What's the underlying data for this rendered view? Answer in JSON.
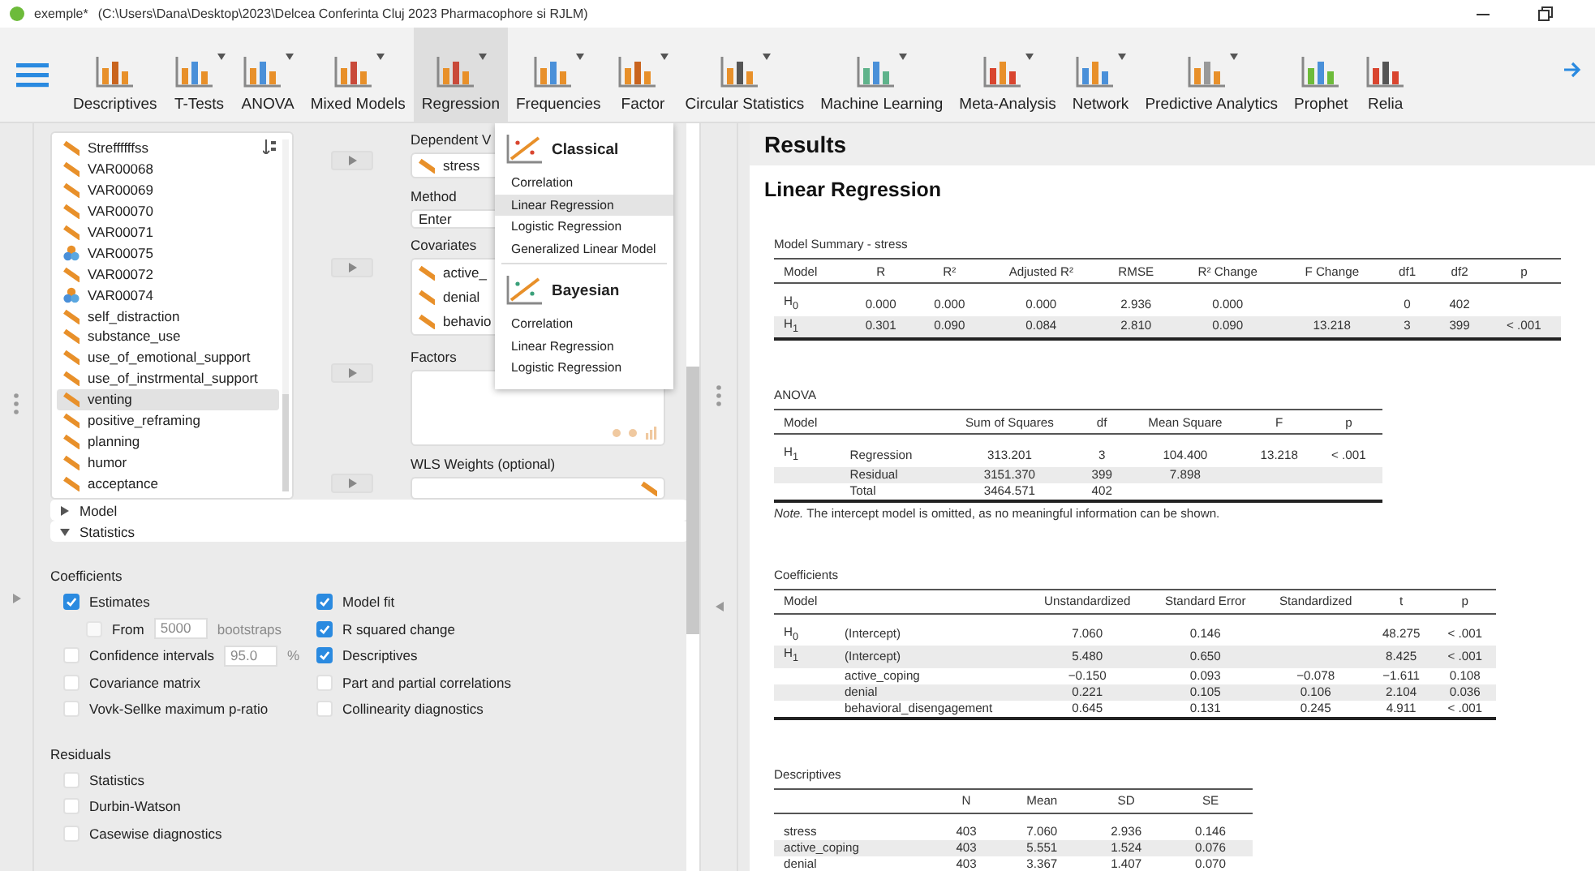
{
  "title_bar": {
    "app": "exemple*",
    "path": "(C:\\Users\\Dana\\Desktop\\2023\\Delcea Conferinta Cluj 2023 Pharmacophore si RJLM)"
  },
  "toolbar": {
    "items": [
      {
        "label": "Descriptives",
        "menu": false,
        "selected": false
      },
      {
        "label": "T-Tests",
        "menu": true,
        "selected": false
      },
      {
        "label": "ANOVA",
        "menu": true,
        "selected": false
      },
      {
        "label": "Mixed Models",
        "menu": true,
        "selected": false
      },
      {
        "label": "Regression",
        "menu": true,
        "selected": true
      },
      {
        "label": "Frequencies",
        "menu": true,
        "selected": false
      },
      {
        "label": "Factor",
        "menu": true,
        "selected": false
      },
      {
        "label": "Circular Statistics",
        "menu": true,
        "selected": false
      },
      {
        "label": "Machine Learning",
        "menu": true,
        "selected": false
      },
      {
        "label": "Meta-Analysis",
        "menu": true,
        "selected": false
      },
      {
        "label": "Network",
        "menu": true,
        "selected": false
      },
      {
        "label": "Predictive Analytics",
        "menu": true,
        "selected": false
      },
      {
        "label": "Prophet",
        "menu": false,
        "selected": false
      },
      {
        "label": "Relia",
        "menu": false,
        "selected": false
      }
    ]
  },
  "variables": [
    {
      "name": "Streffffffss",
      "kind": "scale",
      "selected": false
    },
    {
      "name": "VAR00068",
      "kind": "scale",
      "selected": false
    },
    {
      "name": "VAR00069",
      "kind": "scale",
      "selected": false
    },
    {
      "name": "VAR00070",
      "kind": "scale",
      "selected": false
    },
    {
      "name": "VAR00071",
      "kind": "scale",
      "selected": false
    },
    {
      "name": "VAR00075",
      "kind": "nominal",
      "selected": false
    },
    {
      "name": "VAR00072",
      "kind": "scale",
      "selected": false
    },
    {
      "name": "VAR00074",
      "kind": "nominal",
      "selected": false
    },
    {
      "name": "self_distraction",
      "kind": "scale",
      "selected": false
    },
    {
      "name": "substance_use",
      "kind": "scale",
      "selected": false
    },
    {
      "name": "use_of_emotional_support",
      "kind": "scale",
      "selected": false
    },
    {
      "name": "use_of_instrmental_support",
      "kind": "scale",
      "selected": false
    },
    {
      "name": "venting",
      "kind": "scale",
      "selected": true
    },
    {
      "name": "positive_reframing",
      "kind": "scale",
      "selected": false
    },
    {
      "name": "planning",
      "kind": "scale",
      "selected": false
    },
    {
      "name": "humor",
      "kind": "scale",
      "selected": false
    },
    {
      "name": "acceptance",
      "kind": "scale",
      "selected": false
    }
  ],
  "assign": {
    "dependent_label": "Dependent V",
    "dependent": "stress",
    "method_label": "Method",
    "method": "Enter",
    "covariates_label": "Covariates",
    "covariates": [
      "active_",
      "denial",
      "behavio"
    ],
    "factors_label": "Factors",
    "wls_label": "WLS Weights (optional)"
  },
  "menu": {
    "groups": [
      {
        "title": "Classical",
        "items": [
          {
            "label": "Correlation",
            "selected": false
          },
          {
            "label": "Linear Regression",
            "selected": true
          },
          {
            "label": "Logistic Regression",
            "selected": false
          },
          {
            "label": "Generalized Linear Model",
            "selected": false
          }
        ]
      },
      {
        "title": "Bayesian",
        "items": [
          {
            "label": "Correlation",
            "selected": false
          },
          {
            "label": "Linear Regression",
            "selected": false
          },
          {
            "label": "Logistic Regression",
            "selected": false
          }
        ]
      }
    ]
  },
  "sections": [
    {
      "label": "Model",
      "expanded": false
    },
    {
      "label": "Statistics",
      "expanded": true
    }
  ],
  "coefficients_label": "Coefficients",
  "options_left": [
    {
      "kind": "check",
      "label": "Estimates",
      "checked": true
    },
    {
      "kind": "bootstrap",
      "label": "From",
      "value": "5000",
      "unit": "bootstraps",
      "checked": false
    },
    {
      "kind": "interval",
      "label": "Confidence intervals",
      "value": "95.0",
      "unit": "%",
      "checked": false
    },
    {
      "kind": "check",
      "label": "Covariance matrix",
      "checked": false
    },
    {
      "kind": "check",
      "label": "Vovk-Sellke maximum p-ratio",
      "checked": false
    }
  ],
  "options_right": [
    {
      "kind": "check",
      "label": "Model fit",
      "checked": true
    },
    {
      "kind": "check",
      "label": "R squared change",
      "checked": true
    },
    {
      "kind": "check",
      "label": "Descriptives",
      "checked": true
    },
    {
      "kind": "check",
      "label": "Part and partial correlations",
      "checked": false
    },
    {
      "kind": "check",
      "label": "Collinearity diagnostics",
      "checked": false
    }
  ],
  "residuals": {
    "label": "Residuals",
    "options": [
      {
        "label": "Statistics",
        "checked": false
      },
      {
        "label": "Durbin-Watson",
        "checked": false
      },
      {
        "label": "Casewise diagnostics",
        "checked": false
      }
    ]
  },
  "results": {
    "title": "Results",
    "analysis": "Linear Regression",
    "tables": [
      {
        "title": "Model Summary - stress",
        "columns": [
          {
            "kind": "label",
            "label": "Model"
          },
          {
            "kind": "number",
            "label": "R"
          },
          {
            "kind": "number",
            "label": "R²"
          },
          {
            "kind": "number",
            "label": "Adjusted R²"
          },
          {
            "kind": "number",
            "label": "RMSE"
          },
          {
            "kind": "number",
            "label": "R² Change"
          },
          {
            "kind": "number",
            "label": "F Change"
          },
          {
            "kind": "number",
            "label": "df1"
          },
          {
            "kind": "number",
            "label": "df2"
          },
          {
            "kind": "number",
            "label": "p"
          }
        ],
        "rows": [
          [
            "H$_{0}$",
            "0.000",
            "0.000",
            "0.000",
            "2.936",
            "0.000",
            null,
            "0",
            "402",
            null
          ],
          [
            "H$_{1}$",
            "0.301",
            "0.090",
            "0.084",
            "2.810",
            "0.090",
            "13.218",
            "3",
            "399",
            "< .001"
          ]
        ]
      },
      {
        "title": "ANOVA",
        "columns": [
          {
            "kind": "label",
            "label": "Model"
          },
          {
            "kind": "label"
          },
          {
            "kind": "number",
            "label": "Sum of Squares"
          },
          {
            "kind": "number",
            "label": "df"
          },
          {
            "kind": "number",
            "label": "Mean Square"
          },
          {
            "kind": "number",
            "label": "F"
          },
          {
            "kind": "number",
            "label": "p"
          }
        ],
        "rows": [
          [
            "H$_{1}$",
            "Regression",
            "313.201",
            "3",
            "104.400",
            "13.218",
            "< .001"
          ],
          [
            null,
            "Residual",
            "3151.370",
            "399",
            "7.898",
            null,
            null
          ],
          [
            null,
            "Total",
            "3464.571",
            "402",
            null,
            null,
            null
          ]
        ],
        "note": "*Note.* The intercept model is omitted, as no meaningful information can be shown."
      },
      {
        "title": "Coefficients",
        "columns": [
          {
            "kind": "label",
            "label": "Model"
          },
          {
            "kind": "label"
          },
          {
            "kind": "number",
            "label": "Unstandardized"
          },
          {
            "kind": "number",
            "label": "Standard Error"
          },
          {
            "kind": "number",
            "label": "Standardized"
          },
          {
            "kind": "number",
            "label": "t"
          },
          {
            "kind": "number",
            "label": "p"
          }
        ],
        "rows": [
          [
            "H$_{0}$",
            "(Intercept)",
            "7.060",
            "0.146",
            null,
            "48.275",
            "< .001"
          ],
          [
            "H$_{1}$",
            "(Intercept)",
            "5.480",
            "0.650",
            null,
            "8.425",
            "< .001"
          ],
          [
            null,
            "active_coping",
            "−0.150",
            "0.093",
            "−0.078",
            "−1.611",
            "0.108"
          ],
          [
            null,
            "denial",
            "0.221",
            "0.105",
            "0.106",
            "2.104",
            "0.036"
          ],
          [
            null,
            "behavioral_disengagement",
            "0.645",
            "0.131",
            "0.245",
            "4.911",
            "< .001"
          ]
        ]
      },
      {
        "title": "Descriptives",
        "columns": [
          {
            "kind": "label"
          },
          {
            "kind": "number",
            "label": "N"
          },
          {
            "kind": "number",
            "label": "Mean"
          },
          {
            "kind": "number",
            "label": "SD"
          },
          {
            "kind": "number",
            "label": "SE"
          }
        ],
        "rows": [
          [
            "stress",
            "403",
            "7.060",
            "2.936",
            "0.146"
          ],
          [
            "active_coping",
            "403",
            "5.551",
            "1.524",
            "0.076"
          ],
          [
            "denial",
            "403",
            "3.367",
            "1.407",
            "0.070"
          ]
        ]
      }
    ]
  }
}
